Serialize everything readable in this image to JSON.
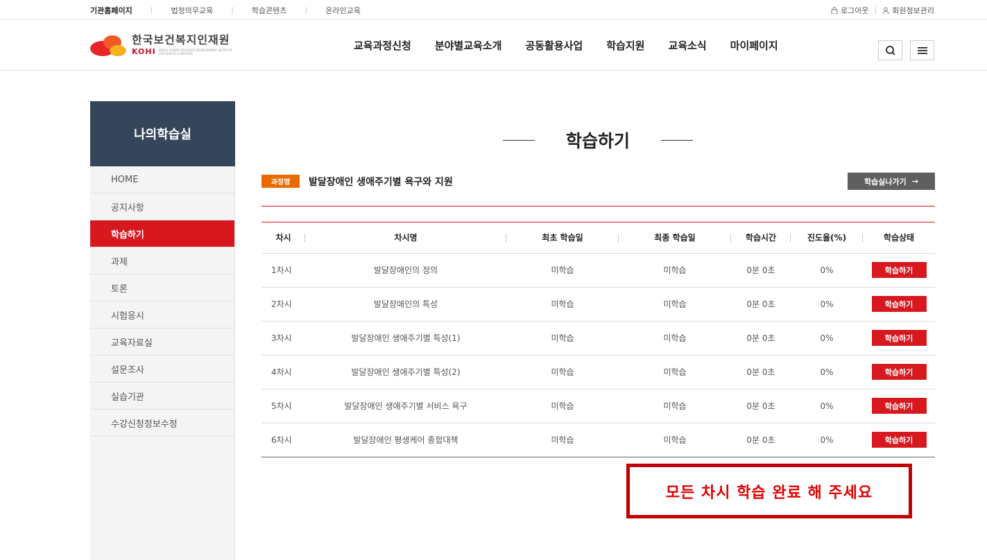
{
  "util": {
    "links": [
      "기관홈페이지",
      "법정의무교육",
      "학습콘텐츠",
      "온라인교육"
    ],
    "logout": "로그아웃",
    "member": "회원정보관리"
  },
  "logo": {
    "name_ko": "한국보건복지인재원",
    "name_en": "KOHI",
    "sub": "KOREA HUMAN RESOURCE DEVELOPMENT INSTITUTE FOR HEALTH & WELFARE"
  },
  "gnb": [
    "교육과정신청",
    "분야별교육소개",
    "공동활용사업",
    "학습지원",
    "교육소식",
    "마이페이지"
  ],
  "sidebar": {
    "title": "나의학습실",
    "items": [
      "HOME",
      "공지사항",
      "학습하기",
      "과제",
      "토론",
      "시험응시",
      "교육자료실",
      "설문조사",
      "실습기관",
      "수강신청정보수정"
    ],
    "active_index": 2
  },
  "page": {
    "title": "학습하기",
    "badge": "과정명",
    "course_name": "발달장애인 생애주기별 욕구와 지원",
    "exit_label": "학습실나가기",
    "exit_arrow": "→"
  },
  "table": {
    "headers": [
      "차시",
      "차시명",
      "최초 학습일",
      "최종 학습일",
      "학습시간",
      "진도율(%)",
      "학습상태"
    ],
    "rows": [
      {
        "no": "1차시",
        "name": "발달장애인의 정의",
        "first": "미학습",
        "last": "미학습",
        "time": "0분 0초",
        "progress": "0%",
        "action": "학습하기"
      },
      {
        "no": "2차시",
        "name": "발달장애인의 특성",
        "first": "미학습",
        "last": "미학습",
        "time": "0분 0초",
        "progress": "0%",
        "action": "학습하기"
      },
      {
        "no": "3차시",
        "name": "발달장애인 생애주기별 특성(1)",
        "first": "미학습",
        "last": "미학습",
        "time": "0분 0초",
        "progress": "0%",
        "action": "학습하기"
      },
      {
        "no": "4차시",
        "name": "발달장애인 생애주기별 특성(2)",
        "first": "미학습",
        "last": "미학습",
        "time": "0분 0초",
        "progress": "0%",
        "action": "학습하기"
      },
      {
        "no": "5차시",
        "name": "발달장애인 생애주기별 서비스 욕구",
        "first": "미학습",
        "last": "미학습",
        "time": "0분 0초",
        "progress": "0%",
        "action": "학습하기"
      },
      {
        "no": "6차시",
        "name": "발달장애인 평생케어 종합대책",
        "first": "미학습",
        "last": "미학습",
        "time": "0분 0초",
        "progress": "0%",
        "action": "학습하기"
      }
    ]
  },
  "notice": "모든 차시 학습 완료 해 주세요",
  "colors": {
    "accent_red": "#d7191f",
    "badge_orange": "#ea6a00",
    "sidebar_title_bg": "#35465b",
    "notice_border": "#c00000"
  },
  "icons": {
    "logout": "lock-icon",
    "member": "person-icon",
    "search": "search-icon",
    "menu": "hamburger-menu-icon"
  }
}
